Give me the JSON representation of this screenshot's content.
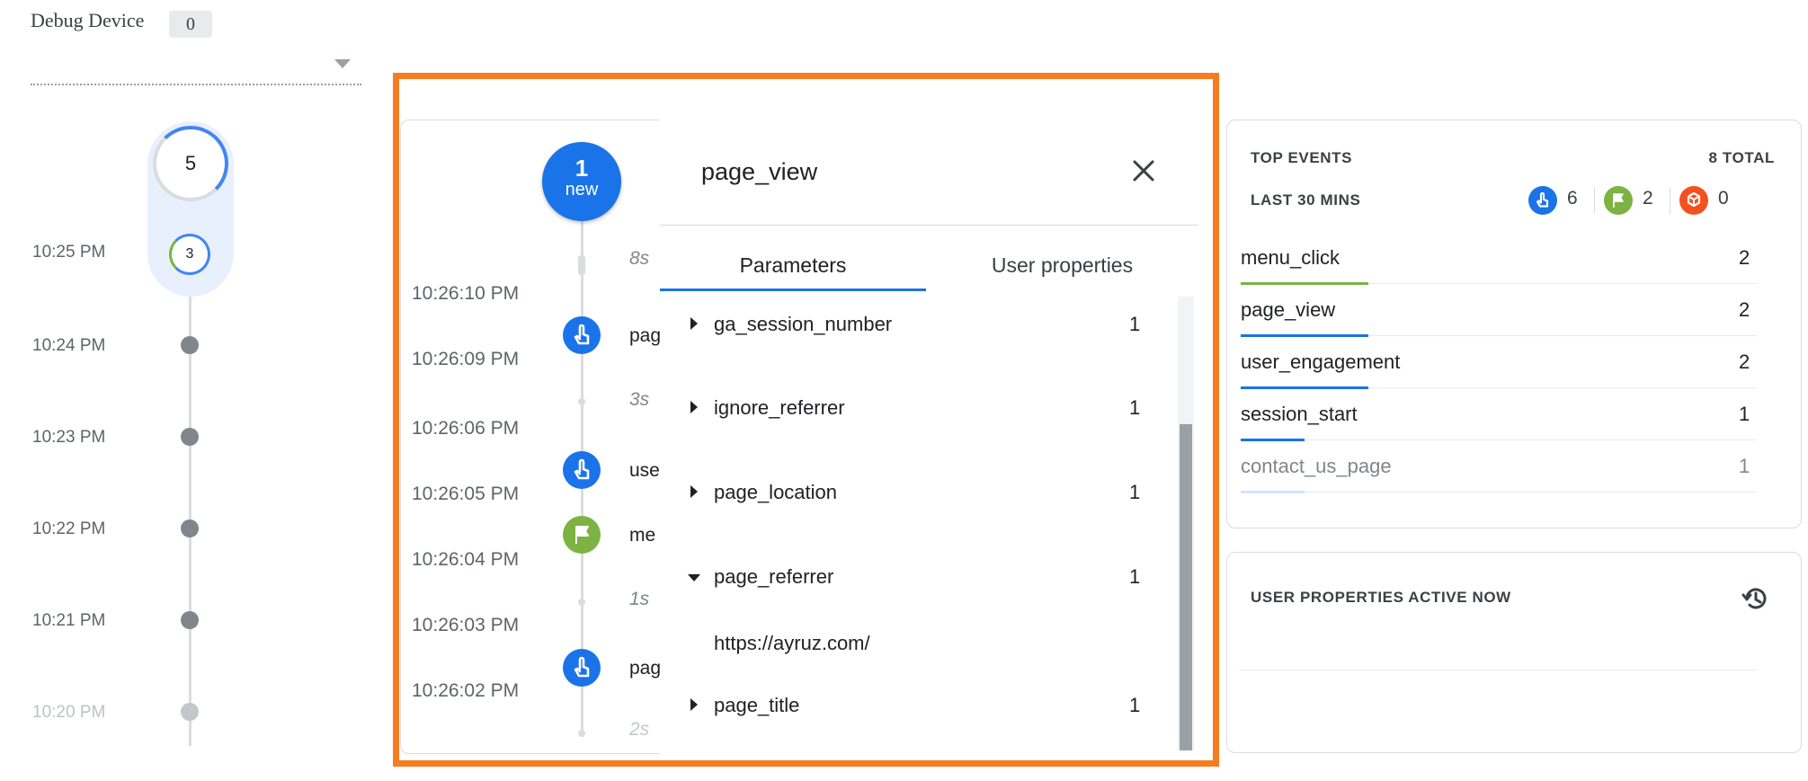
{
  "debug_device": {
    "label": "Debug Device",
    "count": "0"
  },
  "minutes": {
    "counter": "5",
    "current_count": "3",
    "times": [
      "10:25 PM",
      "10:24 PM",
      "10:23 PM",
      "10:22 PM",
      "10:21 PM",
      "10:20 PM"
    ]
  },
  "seconds": {
    "new_count": "1",
    "new_label": "new",
    "times": [
      "10:26:10 PM",
      "10:26:09 PM",
      "10:26:06 PM",
      "10:26:05 PM",
      "10:26:04 PM",
      "10:26:03 PM",
      "10:26:02 PM"
    ],
    "gaps": [
      "8s",
      "3s",
      "1s",
      "2s"
    ],
    "events": [
      {
        "label": "pag",
        "icon": "touch-icon",
        "color": "#1a73e8"
      },
      {
        "label": "use",
        "icon": "touch-icon",
        "color": "#1a73e8"
      },
      {
        "label": "me",
        "icon": "flag-icon",
        "color": "#7cb342"
      },
      {
        "label": "pag",
        "icon": "touch-icon",
        "color": "#1a73e8"
      }
    ]
  },
  "detail": {
    "title": "page_view",
    "tabs": {
      "parameters": "Parameters",
      "user_properties": "User properties"
    },
    "params": [
      {
        "name": "ga_session_number",
        "count": "1",
        "expanded": false
      },
      {
        "name": "ignore_referrer",
        "count": "1",
        "expanded": false
      },
      {
        "name": "page_location",
        "count": "1",
        "expanded": false
      },
      {
        "name": "page_referrer",
        "count": "1",
        "expanded": true
      },
      {
        "name": "page_title",
        "count": "1",
        "expanded": false
      }
    ],
    "expanded_value": "https://ayruz.com/"
  },
  "top_events": {
    "heading": "TOP EVENTS",
    "total": "8 TOTAL",
    "period": "LAST 30 MINS",
    "legend": [
      {
        "icon": "touch-icon",
        "count": "6",
        "color": "#1a73e8"
      },
      {
        "icon": "flag-icon",
        "count": "2",
        "color": "#7cb342"
      },
      {
        "icon": "error-icon",
        "count": "0",
        "color": "#f4511e"
      }
    ],
    "events": [
      {
        "name": "menu_click",
        "count": "2",
        "bar_color": "#7cb342",
        "share": 1.0
      },
      {
        "name": "page_view",
        "count": "2",
        "bar_color": "#1a73e8",
        "share": 1.0
      },
      {
        "name": "user_engagement",
        "count": "2",
        "bar_color": "#1a73e8",
        "share": 1.0
      },
      {
        "name": "session_start",
        "count": "1",
        "bar_color": "#1a73e8",
        "share": 0.5
      },
      {
        "name": "contact_us_page",
        "count": "1",
        "bar_color": "#d2e3fc",
        "share": 0.5
      }
    ]
  },
  "user_properties": {
    "heading": "USER PROPERTIES ACTIVE NOW"
  }
}
